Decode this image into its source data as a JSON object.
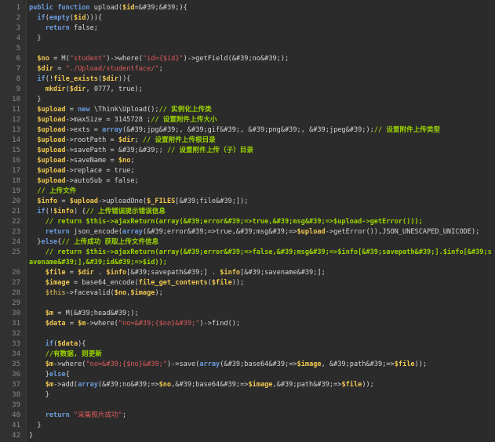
{
  "editor": {
    "lines": [
      {
        "n": "1",
        "tokens": [
          [
            "kw",
            "public function "
          ],
          [
            "tx",
            "upload("
          ],
          [
            "var",
            "$id"
          ],
          [
            "tx",
            "=&#39;&#39;){"
          ]
        ]
      },
      {
        "n": "2",
        "tokens": [
          [
            "tx",
            "  "
          ],
          [
            "kw",
            "if"
          ],
          [
            "tx",
            "("
          ],
          [
            "kw",
            "empty"
          ],
          [
            "tx",
            "("
          ],
          [
            "var",
            "$id"
          ],
          [
            "tx",
            "))){"
          ]
        ]
      },
      {
        "n": "3",
        "tokens": [
          [
            "tx",
            "    "
          ],
          [
            "kw",
            "return "
          ],
          [
            "tx",
            "false;"
          ]
        ]
      },
      {
        "n": "4",
        "tokens": [
          [
            "tx",
            "  }"
          ]
        ]
      },
      {
        "n": "5",
        "tokens": []
      },
      {
        "n": "6",
        "tokens": [
          [
            "tx",
            "  "
          ],
          [
            "var",
            "$no"
          ],
          [
            "tx",
            " = M("
          ],
          [
            "str",
            "\"student\""
          ],
          [
            "tx",
            ")->where("
          ],
          [
            "str",
            "\"id={$id}\""
          ],
          [
            "tx",
            ")->getField(&#39;no&#39;);"
          ]
        ]
      },
      {
        "n": "7",
        "tokens": [
          [
            "tx",
            "  "
          ],
          [
            "var",
            "$dir"
          ],
          [
            "tx",
            " = "
          ],
          [
            "str",
            "\"./Upload/studentface/\""
          ],
          [
            "tx",
            ";"
          ]
        ]
      },
      {
        "n": "8",
        "tokens": [
          [
            "tx",
            "  "
          ],
          [
            "kw",
            "if"
          ],
          [
            "tx",
            "(!"
          ],
          [
            "fn",
            "file_exists"
          ],
          [
            "tx",
            "("
          ],
          [
            "var",
            "$dir"
          ],
          [
            "tx",
            ")){"
          ]
        ]
      },
      {
        "n": "9",
        "tokens": [
          [
            "tx",
            "    "
          ],
          [
            "fn",
            "mkdir"
          ],
          [
            "tx",
            "("
          ],
          [
            "var",
            "$dir"
          ],
          [
            "tx",
            ", 0777, true);"
          ]
        ]
      },
      {
        "n": "10",
        "tokens": [
          [
            "tx",
            "  }"
          ]
        ]
      },
      {
        "n": "11",
        "tokens": [
          [
            "tx",
            "  "
          ],
          [
            "var",
            "$upload"
          ],
          [
            "tx",
            " = "
          ],
          [
            "kw",
            "new"
          ],
          [
            "tx",
            " \\Think\\Upload();"
          ],
          [
            "cm",
            "// 实例化上传类"
          ]
        ]
      },
      {
        "n": "12",
        "tokens": [
          [
            "tx",
            "  "
          ],
          [
            "var",
            "$upload"
          ],
          [
            "tx",
            "->maxSize = 3145728 ;"
          ],
          [
            "cm",
            "// 设置附件上传大小"
          ]
        ]
      },
      {
        "n": "13",
        "tokens": [
          [
            "tx",
            "  "
          ],
          [
            "var",
            "$upload"
          ],
          [
            "tx",
            "->exts = "
          ],
          [
            "kw",
            "array"
          ],
          [
            "tx",
            "(&#39;jpg&#39;, &#39;gif&#39;, &#39;png&#39;, &#39;jpeg&#39;);"
          ],
          [
            "cm",
            "// 设置附件上传类型"
          ]
        ]
      },
      {
        "n": "14",
        "tokens": [
          [
            "tx",
            "  "
          ],
          [
            "var",
            "$upload"
          ],
          [
            "tx",
            "->rootPath = "
          ],
          [
            "var",
            "$dir"
          ],
          [
            "tx",
            "; "
          ],
          [
            "cm",
            "// 设置附件上传根目录"
          ]
        ]
      },
      {
        "n": "15",
        "tokens": [
          [
            "tx",
            "  "
          ],
          [
            "var",
            "$upload"
          ],
          [
            "tx",
            "->savePath = &#39;&#39;; "
          ],
          [
            "cm",
            "// 设置附件上传（子）目录"
          ]
        ]
      },
      {
        "n": "16",
        "tokens": [
          [
            "tx",
            "  "
          ],
          [
            "var",
            "$upload"
          ],
          [
            "tx",
            "->saveName = "
          ],
          [
            "var",
            "$no"
          ],
          [
            "tx",
            ";"
          ]
        ]
      },
      {
        "n": "17",
        "tokens": [
          [
            "tx",
            "  "
          ],
          [
            "var",
            "$upload"
          ],
          [
            "tx",
            "->replace = true;"
          ]
        ]
      },
      {
        "n": "18",
        "tokens": [
          [
            "tx",
            "  "
          ],
          [
            "var",
            "$upload"
          ],
          [
            "tx",
            "->autoSub = false;"
          ]
        ]
      },
      {
        "n": "19",
        "tokens": [
          [
            "tx",
            "  "
          ],
          [
            "cm",
            "// 上传文件"
          ]
        ]
      },
      {
        "n": "20",
        "tokens": [
          [
            "tx",
            "  "
          ],
          [
            "var",
            "$info"
          ],
          [
            "tx",
            " = "
          ],
          [
            "var",
            "$upload"
          ],
          [
            "tx",
            "->uploadOne("
          ],
          [
            "var",
            "$_FILES"
          ],
          [
            "tx",
            "[&#39;file&#39;]);"
          ]
        ]
      },
      {
        "n": "21",
        "tokens": [
          [
            "tx",
            "  "
          ],
          [
            "kw",
            "if"
          ],
          [
            "tx",
            "(!"
          ],
          [
            "var",
            "$info"
          ],
          [
            "tx",
            ") {"
          ],
          [
            "cm",
            "// 上传错误提示错误信息"
          ]
        ]
      },
      {
        "n": "22",
        "tokens": [
          [
            "tx",
            "    "
          ],
          [
            "cm",
            "// return $this->ajaxReturn(array(&#39;error&#39;=>true,&#39;msg&#39;=>$upload->getError()));"
          ]
        ]
      },
      {
        "n": "23",
        "tokens": [
          [
            "tx",
            "    "
          ],
          [
            "kw",
            "return "
          ],
          [
            "tx",
            "json_encode("
          ],
          [
            "kw",
            "array"
          ],
          [
            "tx",
            "(&#39;error&#39;=>true,&#39;msg&#39;=>"
          ],
          [
            "var",
            "$upload"
          ],
          [
            "tx",
            "->getError()),JSON_UNESCAPED_UNICODE);"
          ]
        ]
      },
      {
        "n": "24",
        "tokens": [
          [
            "tx",
            "  }"
          ],
          [
            "kw",
            "else"
          ],
          [
            "tx",
            "{"
          ],
          [
            "cm",
            "// 上传成功 获取上传文件信息"
          ]
        ]
      },
      {
        "n": "25",
        "tokens": [
          [
            "tx",
            "    "
          ],
          [
            "cm",
            "// return $this->ajaxReturn(array(&#39;error&#39;=>false,&#39;msg&#39;=>$info[&#39;savepath&#39;].$info[&#39;s"
          ]
        ]
      },
      {
        "n": "",
        "tokens": [
          [
            "cm",
            "avename&#39;],&#39;id&#39;=>$id));"
          ]
        ]
      },
      {
        "n": "26",
        "tokens": [
          [
            "tx",
            "    "
          ],
          [
            "var",
            "$file"
          ],
          [
            "tx",
            " = "
          ],
          [
            "var",
            "$dir"
          ],
          [
            "tx",
            " . "
          ],
          [
            "var",
            "$info"
          ],
          [
            "tx",
            "[&#39;savepath&#39;] . "
          ],
          [
            "var",
            "$info"
          ],
          [
            "tx",
            "[&#39;savename&#39;];"
          ]
        ]
      },
      {
        "n": "27",
        "tokens": [
          [
            "tx",
            "    "
          ],
          [
            "var",
            "$image"
          ],
          [
            "tx",
            " = base64_encode("
          ],
          [
            "fn",
            "file_get_contents"
          ],
          [
            "tx",
            "("
          ],
          [
            "var",
            "$file"
          ],
          [
            "tx",
            "));"
          ]
        ]
      },
      {
        "n": "28",
        "tokens": [
          [
            "tx",
            "    "
          ],
          [
            "bi",
            "$this"
          ],
          [
            "tx",
            "->facevalid("
          ],
          [
            "var",
            "$no"
          ],
          [
            "tx",
            ","
          ],
          [
            "var",
            "$image"
          ],
          [
            "tx",
            ");"
          ]
        ]
      },
      {
        "n": "29",
        "tokens": []
      },
      {
        "n": "30",
        "tokens": [
          [
            "tx",
            "    "
          ],
          [
            "var",
            "$m"
          ],
          [
            "tx",
            " = M(&#39;head&#39;);"
          ]
        ]
      },
      {
        "n": "31",
        "tokens": [
          [
            "tx",
            "    "
          ],
          [
            "var",
            "$data"
          ],
          [
            "tx",
            " = "
          ],
          [
            "var",
            "$m"
          ],
          [
            "tx",
            "->where("
          ],
          [
            "str",
            "\"no=&#39;{$no}&#39;\""
          ],
          [
            "tx",
            ")->find();"
          ]
        ]
      },
      {
        "n": "32",
        "tokens": []
      },
      {
        "n": "33",
        "tokens": [
          [
            "tx",
            "    "
          ],
          [
            "kw",
            "if"
          ],
          [
            "tx",
            "("
          ],
          [
            "var",
            "$data"
          ],
          [
            "tx",
            "){"
          ]
        ]
      },
      {
        "n": "34",
        "tokens": [
          [
            "tx",
            "    "
          ],
          [
            "cm",
            "//有数据, 则更新"
          ]
        ]
      },
      {
        "n": "35",
        "tokens": [
          [
            "tx",
            "    "
          ],
          [
            "var",
            "$m"
          ],
          [
            "tx",
            "->where("
          ],
          [
            "str",
            "\"no=&#39;{$no}&#39;\""
          ],
          [
            "tx",
            ")->save("
          ],
          [
            "kw",
            "array"
          ],
          [
            "tx",
            "(&#39;base64&#39;=>"
          ],
          [
            "var",
            "$image"
          ],
          [
            "tx",
            ", &#39;path&#39;=>"
          ],
          [
            "var",
            "$file"
          ],
          [
            "tx",
            "));"
          ]
        ]
      },
      {
        "n": "36",
        "tokens": [
          [
            "tx",
            "    }"
          ],
          [
            "kw",
            "else"
          ],
          [
            "tx",
            "{"
          ]
        ]
      },
      {
        "n": "37",
        "tokens": [
          [
            "tx",
            "    "
          ],
          [
            "var",
            "$m"
          ],
          [
            "tx",
            "->add("
          ],
          [
            "kw",
            "array"
          ],
          [
            "tx",
            "(&#39;no&#39;=>"
          ],
          [
            "var",
            "$no"
          ],
          [
            "tx",
            ",&#39;base64&#39;=>"
          ],
          [
            "var",
            "$image"
          ],
          [
            "tx",
            ",&#39;path&#39;=>"
          ],
          [
            "var",
            "$file"
          ],
          [
            "tx",
            "));"
          ]
        ]
      },
      {
        "n": "38",
        "tokens": [
          [
            "tx",
            "    }"
          ]
        ]
      },
      {
        "n": "39",
        "tokens": []
      },
      {
        "n": "40",
        "tokens": [
          [
            "tx",
            "    "
          ],
          [
            "kw",
            "return "
          ],
          [
            "str",
            "\"采集照片成功\""
          ],
          [
            "tx",
            ";"
          ]
        ]
      },
      {
        "n": "41",
        "tokens": [
          [
            "tx",
            "  }"
          ]
        ]
      },
      {
        "n": "42",
        "tokens": [
          [
            "tx",
            "}"
          ]
        ]
      }
    ]
  },
  "colors": {
    "background": "#2b2b2b",
    "gutter": "#313131",
    "keyword": "#6a9bdc",
    "variable": "#f0c750",
    "string": "#e05b5b",
    "comment": "#9bd400",
    "text": "#d6d6d6"
  }
}
